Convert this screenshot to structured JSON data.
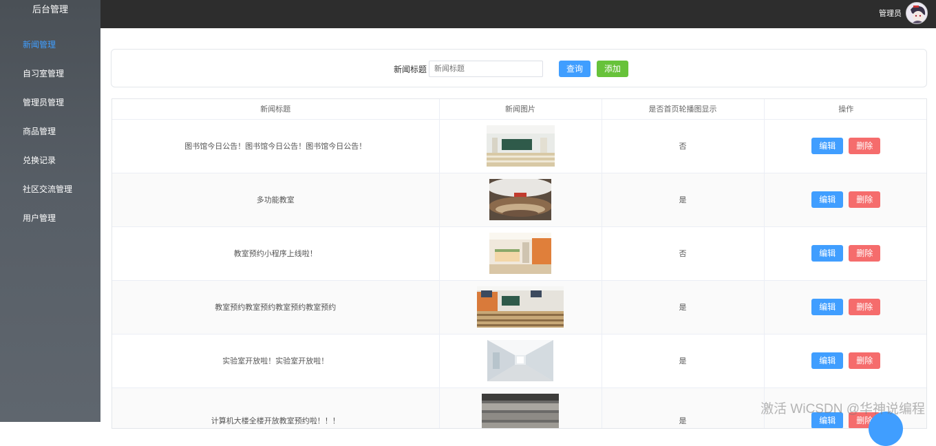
{
  "app": {
    "title": "后台管理"
  },
  "sidebar": {
    "items": [
      {
        "label": "新闻管理",
        "active": true
      },
      {
        "label": "自习室管理",
        "active": false
      },
      {
        "label": "管理员管理",
        "active": false
      },
      {
        "label": "商品管理",
        "active": false
      },
      {
        "label": "兑换记录",
        "active": false
      },
      {
        "label": "社区交流管理",
        "active": false
      },
      {
        "label": "用户管理",
        "active": false
      }
    ]
  },
  "header": {
    "user_label": "管理员",
    "avatar_icon": "avatar-icon"
  },
  "search": {
    "label": "新闻标题",
    "placeholder": "新闻标题",
    "value": "",
    "query_button": "查询",
    "add_button": "添加"
  },
  "table": {
    "columns": [
      "新闻标题",
      "新闻图片",
      "是否首页轮播图显示",
      "操作"
    ],
    "rows": [
      {
        "title": "图书馆今日公告！图书馆今日公告！图书馆今日公告！",
        "image": "classroom-photo-1",
        "carousel": "否"
      },
      {
        "title": "多功能教室",
        "image": "lecture-hall-photo",
        "carousel": "是"
      },
      {
        "title": "教室预约小程序上线啦！",
        "image": "lobby-photo",
        "carousel": "否"
      },
      {
        "title": "教室预约教室预约教室预约教室预约",
        "image": "classroom-photo-2",
        "carousel": "是"
      },
      {
        "title": "实验室开放啦！实验室开放啦！",
        "image": "lab-corridor-photo",
        "carousel": "是"
      },
      {
        "title": "计算机大楼全楼开放教室预约啦！！！",
        "image": "computer-room-photo",
        "carousel": "是"
      }
    ],
    "edit_label": "编辑",
    "delete_label": "删除"
  },
  "watermark": "激活 WiCSDN @华神说编程",
  "colors": {
    "accent": "#409eff",
    "success": "#67c23a",
    "danger": "#f56c6c",
    "sidebar": "#545b62",
    "topbar": "#2d2d2d"
  }
}
